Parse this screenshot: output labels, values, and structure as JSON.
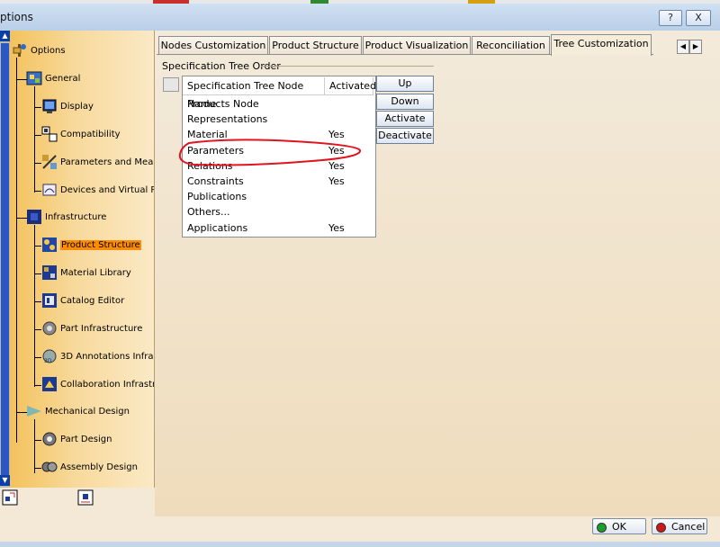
{
  "window": {
    "title": "ptions",
    "help_button": "?",
    "close_button": "X"
  },
  "tree": {
    "items": [
      {
        "label": "Options",
        "icon": "options-icon"
      },
      {
        "label": "General",
        "icon": "general-icon"
      },
      {
        "label": "Display",
        "icon": "display-icon"
      },
      {
        "label": "Compatibility",
        "icon": "compatibility-icon"
      },
      {
        "label": "Parameters and Meas",
        "icon": "parameters-icon"
      },
      {
        "label": "Devices and Virtual Re",
        "icon": "devices-icon"
      },
      {
        "label": "Infrastructure",
        "icon": "infrastructure-icon"
      },
      {
        "label": "Product Structure",
        "icon": "product-structure-icon"
      },
      {
        "label": "Material Library",
        "icon": "material-library-icon"
      },
      {
        "label": "Catalog Editor",
        "icon": "catalog-editor-icon"
      },
      {
        "label": "Part Infrastructure",
        "icon": "part-infrastructure-icon"
      },
      {
        "label": "3D Annotations Infra",
        "icon": "3d-annotations-icon"
      },
      {
        "label": "Collaboration Infrastr",
        "icon": "collaboration-icon"
      },
      {
        "label": "Mechanical Design",
        "icon": "mechanical-design-icon"
      },
      {
        "label": "Part Design",
        "icon": "part-design-icon"
      },
      {
        "label": "Assembly Design",
        "icon": "assembly-design-icon"
      }
    ],
    "selected": "Product Structure"
  },
  "tabs": [
    {
      "label": "Nodes Customization"
    },
    {
      "label": "Product Structure"
    },
    {
      "label": "Product Visualization"
    },
    {
      "label": "Reconciliation"
    },
    {
      "label": "Tree Customization"
    }
  ],
  "active_tab": "Tree Customization",
  "tab_scroll": {
    "left": "◀",
    "right": "▶"
  },
  "group": {
    "title": "Specification Tree Order"
  },
  "table": {
    "headers": [
      "Specification Tree Node Name",
      "Activated"
    ],
    "rows": [
      {
        "name": "Products Node",
        "activated": ""
      },
      {
        "name": "Representations",
        "activated": ""
      },
      {
        "name": "Material",
        "activated": "Yes"
      },
      {
        "name": "Parameters",
        "activated": "Yes"
      },
      {
        "name": "Relations",
        "activated": "Yes"
      },
      {
        "name": "Constraints",
        "activated": "Yes"
      },
      {
        "name": "Publications",
        "activated": ""
      },
      {
        "name": "Others...",
        "activated": ""
      },
      {
        "name": "Applications",
        "activated": "Yes"
      }
    ]
  },
  "buttons": {
    "up": "Up",
    "down": "Down",
    "activate": "Activate",
    "deactivate": "Deactivate",
    "ok": "OK",
    "cancel": "Cancel"
  },
  "colors": {
    "annotation": "#e0141e",
    "selection": "#ff8c00",
    "ok_dot": "#1aa02a",
    "cancel_dot": "#d01818"
  }
}
